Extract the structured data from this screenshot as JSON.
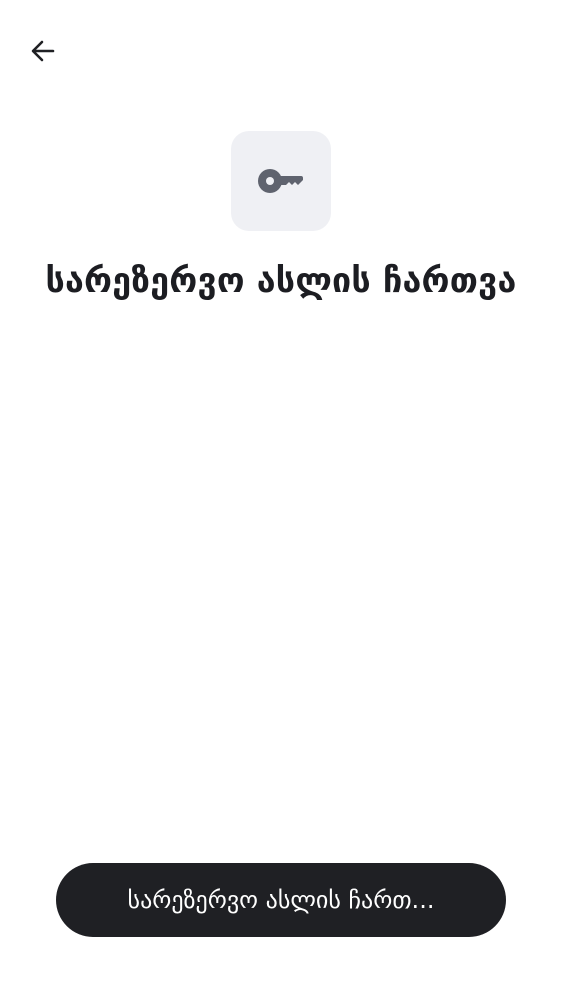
{
  "header": {
    "back_icon": "arrow-left-icon"
  },
  "hero": {
    "icon": "key-icon",
    "title": "სარეზერვო ასლის ჩართვა"
  },
  "footer": {
    "primary_label": "სარეზერვო ასლის ჩართ..."
  },
  "colors": {
    "background": "#ffffff",
    "icon_tile": "#eff0f4",
    "icon": "#5f636e",
    "text": "#1c1d22",
    "button": "#1f2024",
    "button_text": "#ffffff"
  }
}
